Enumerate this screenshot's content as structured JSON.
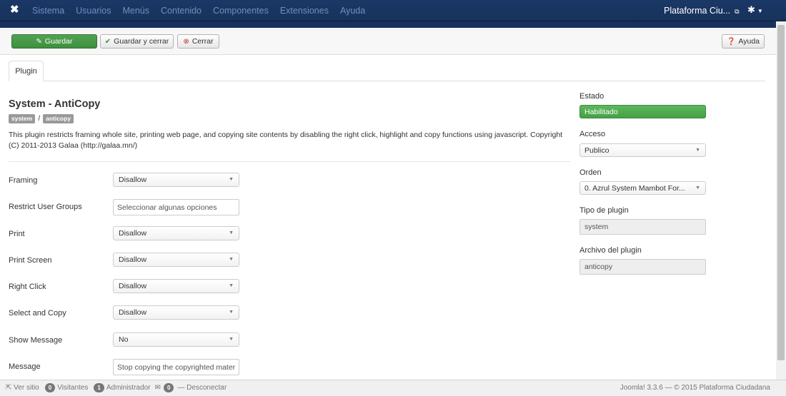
{
  "navbar": {
    "menu": [
      "Sistema",
      "Usuarios",
      "Menús",
      "Contenido",
      "Componentes",
      "Extensiones",
      "Ayuda"
    ],
    "site_name": "Plataforma Ciu...",
    "brand_icon": "joomla-logo-icon",
    "settings_icon": "gear-icon"
  },
  "toolbar": {
    "save_label": "Guardar",
    "save_close_label": "Guardar y cerrar",
    "close_label": "Cerrar",
    "help_label": "Ayuda",
    "accent_color": "#51a351"
  },
  "tabs": [
    "Plugin"
  ],
  "plugin": {
    "title": "System - AntiCopy",
    "tags": [
      "system",
      "anticopy"
    ],
    "description": "This plugin restricts framing whole site, printing web page, and copying site contents by disabling the right click, highlight and copy functions using javascript. Copyright (C) 2011-2013 Galaa (http://galaa.mn/)"
  },
  "fields": [
    {
      "label": "Framing",
      "value": "Disallow"
    },
    {
      "label": "Restrict User Groups",
      "placeholder": "Seleccionar algunas opciones"
    },
    {
      "label": "Print",
      "value": "Disallow"
    },
    {
      "label": "Print Screen",
      "value": "Disallow"
    },
    {
      "label": "Right Click",
      "value": "Disallow"
    },
    {
      "label": "Select and Copy",
      "value": "Disallow"
    },
    {
      "label": "Show Message",
      "value": "No"
    },
    {
      "label": "Message",
      "value": "Stop copying the copyrighted mater"
    }
  ],
  "sidebar": {
    "status_label": "Estado",
    "status_value": "Habilitado",
    "access_label": "Acceso",
    "access_value": "Publico",
    "order_label": "Orden",
    "order_value": "0. Azrul System Mambot For...",
    "type_label": "Tipo de plugin",
    "type_value": "system",
    "file_label": "Archivo del plugin",
    "file_value": "anticopy"
  },
  "statusbar": {
    "view_site": "Ver sitio",
    "visitors_count": "0",
    "visitors_label": "Visitantes",
    "admins_count": "1",
    "admins_label": "Administrador",
    "messages_count": "0",
    "logout_label": "Desconectar",
    "footer": "Joomla! 3.3.6 — © 2015 Plataforma Ciudadana"
  }
}
